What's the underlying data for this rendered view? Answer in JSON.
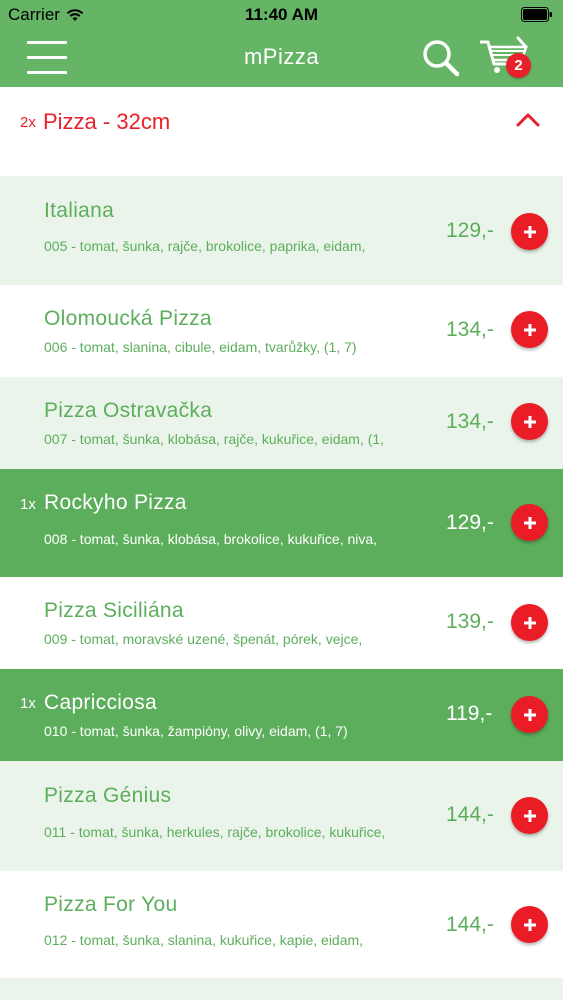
{
  "status_bar": {
    "carrier": "Carrier",
    "time": "11:40 AM"
  },
  "nav": {
    "title": "mPizza",
    "cart_count": "2"
  },
  "category": {
    "quantity": "2x",
    "name": "Pizza - 32cm"
  },
  "colors": {
    "accent_green": "#66b466",
    "red": "#e8202a",
    "light_row": "#ebf4eb",
    "selected_row": "#5cae5c"
  },
  "items": [
    {
      "name": "Italiana",
      "description": "005 - tomat, šunka, rajče, brokolice, paprika, eidam,",
      "price": "129,-",
      "quantity": "",
      "selected": false
    },
    {
      "name": "Olomoucká Pizza",
      "description": "006 - tomat, slanina, cibule, eidam, tvarůžky, (1, 7)",
      "price": "134,-",
      "quantity": "",
      "selected": false
    },
    {
      "name": "Pizza Ostravačka",
      "description": "007 - tomat, šunka, klobása, rajče, kukuřice, eidam, (1,",
      "price": "134,-",
      "quantity": "",
      "selected": false
    },
    {
      "name": "Rockyho Pizza",
      "description": "008 - tomat, šunka, klobása, brokolice, kukuřice, niva,",
      "price": "129,-",
      "quantity": "1x",
      "selected": true
    },
    {
      "name": "Pizza Siciliána",
      "description": "009 - tomat, moravské uzené, špenát, pórek, vejce,",
      "price": "139,-",
      "quantity": "",
      "selected": false
    },
    {
      "name": "Capricciosa",
      "description": "010 - tomat, šunka, žampióny, olivy, eidam, (1, 7)",
      "price": "119,-",
      "quantity": "1x",
      "selected": true
    },
    {
      "name": "Pizza Génius",
      "description": "011 - tomat, šunka, herkules, rajče, brokolice, kukuřice,",
      "price": "144,-",
      "quantity": "",
      "selected": false
    },
    {
      "name": "Pizza For You",
      "description": "012 - tomat, šunka, slanina, kukuřice, kapie, eidam,",
      "price": "144,-",
      "quantity": "",
      "selected": false
    }
  ]
}
